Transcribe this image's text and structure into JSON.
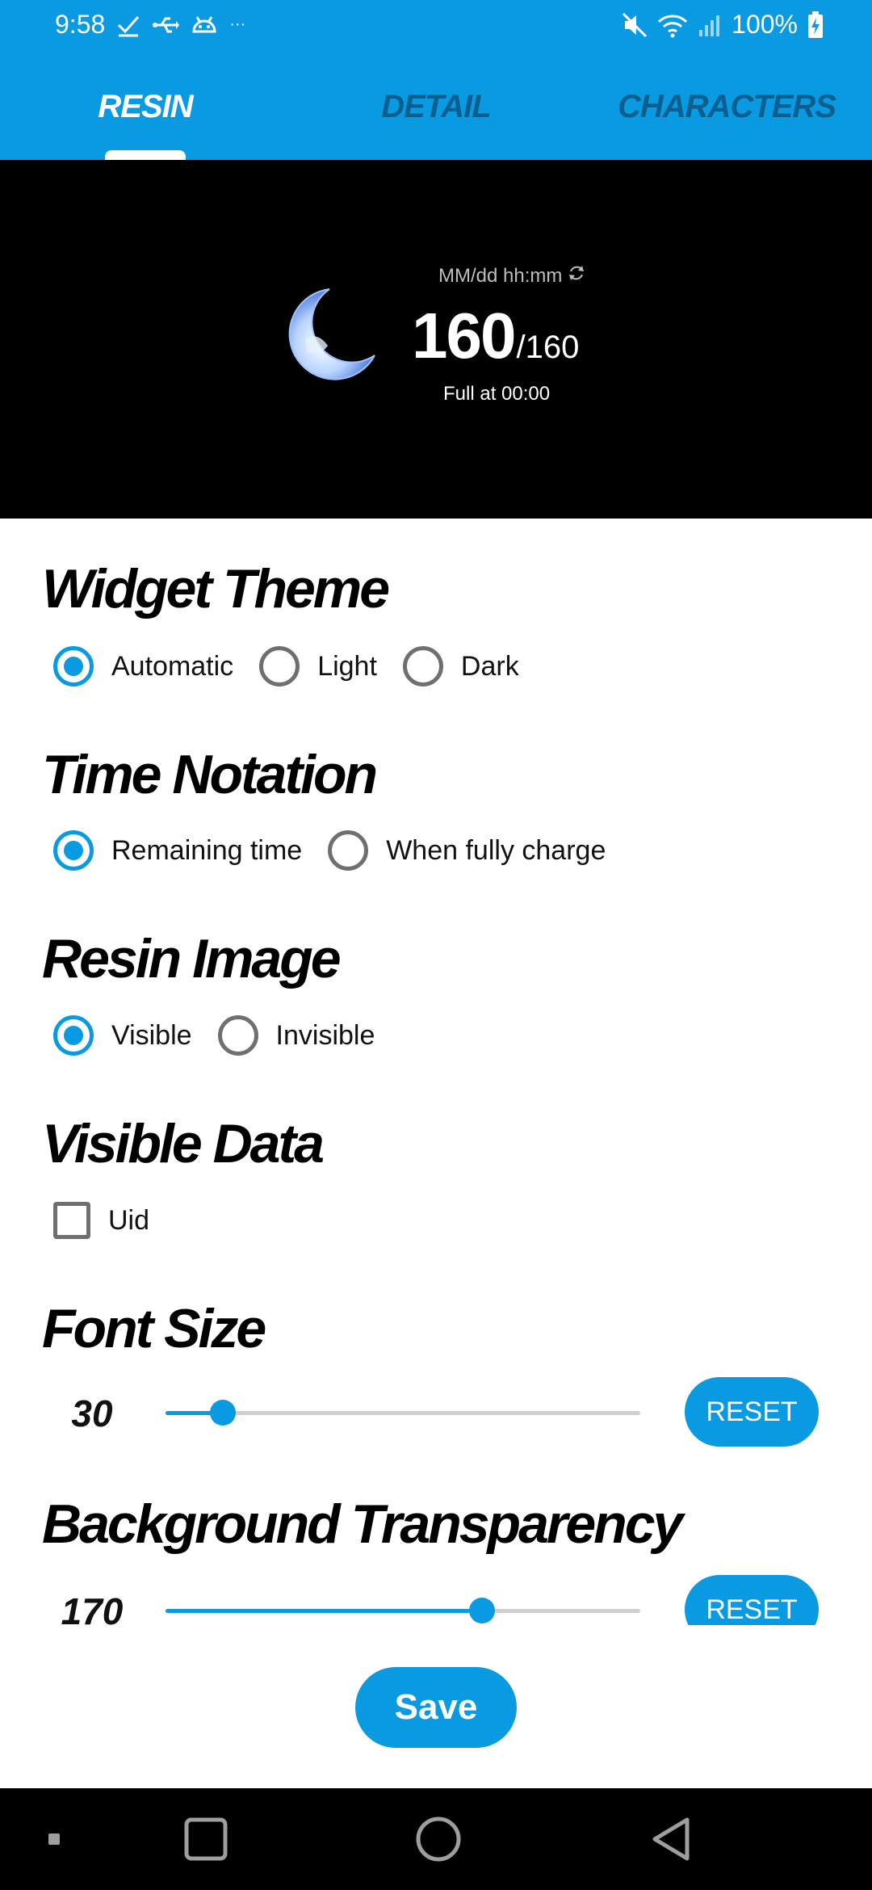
{
  "status_bar": {
    "time": "9:58",
    "battery": "100%",
    "icons_left": [
      "check-icon",
      "usb-icon",
      "android-debug-icon",
      "more-icon"
    ],
    "icons_right": [
      "mute-icon",
      "wifi-icon",
      "signal-icon",
      "battery-charging-icon"
    ],
    "more": "···"
  },
  "tabs": [
    {
      "label": "RESIN",
      "active": true
    },
    {
      "label": "DETAIL",
      "active": false
    },
    {
      "label": "CHARACTERS",
      "active": false
    }
  ],
  "preview": {
    "time_format": "MM/dd hh:mm",
    "current": "160",
    "max": "/160",
    "full_at": "Full at 00:00"
  },
  "sections": {
    "widget_theme": {
      "title": "Widget Theme",
      "options": [
        {
          "label": "Automatic",
          "checked": true
        },
        {
          "label": "Light",
          "checked": false
        },
        {
          "label": "Dark",
          "checked": false
        }
      ]
    },
    "time_notation": {
      "title": "Time Notation",
      "options": [
        {
          "label": "Remaining time",
          "checked": true
        },
        {
          "label": "When fully charge",
          "checked": false
        }
      ]
    },
    "resin_image": {
      "title": "Resin Image",
      "options": [
        {
          "label": "Visible",
          "checked": true
        },
        {
          "label": "Invisible",
          "checked": false
        }
      ]
    },
    "visible_data": {
      "title": "Visible Data",
      "options": [
        {
          "label": "Uid",
          "checked": false
        }
      ]
    },
    "font_size": {
      "title": "Font Size",
      "value": "30",
      "fraction": 0.12,
      "reset_label": "RESET"
    },
    "background_transparency": {
      "title": "Background Transparency",
      "value": "170",
      "fraction": 0.667,
      "reset_label": "RESET"
    }
  },
  "save_label": "Save",
  "colors": {
    "accent": "#0a9ae2",
    "tab_inactive": "#0b5f8e",
    "preview_bg": "#000000"
  },
  "nav_bar": [
    "recents-dot-icon",
    "square-icon",
    "home-circle-icon",
    "back-triangle-icon"
  ]
}
